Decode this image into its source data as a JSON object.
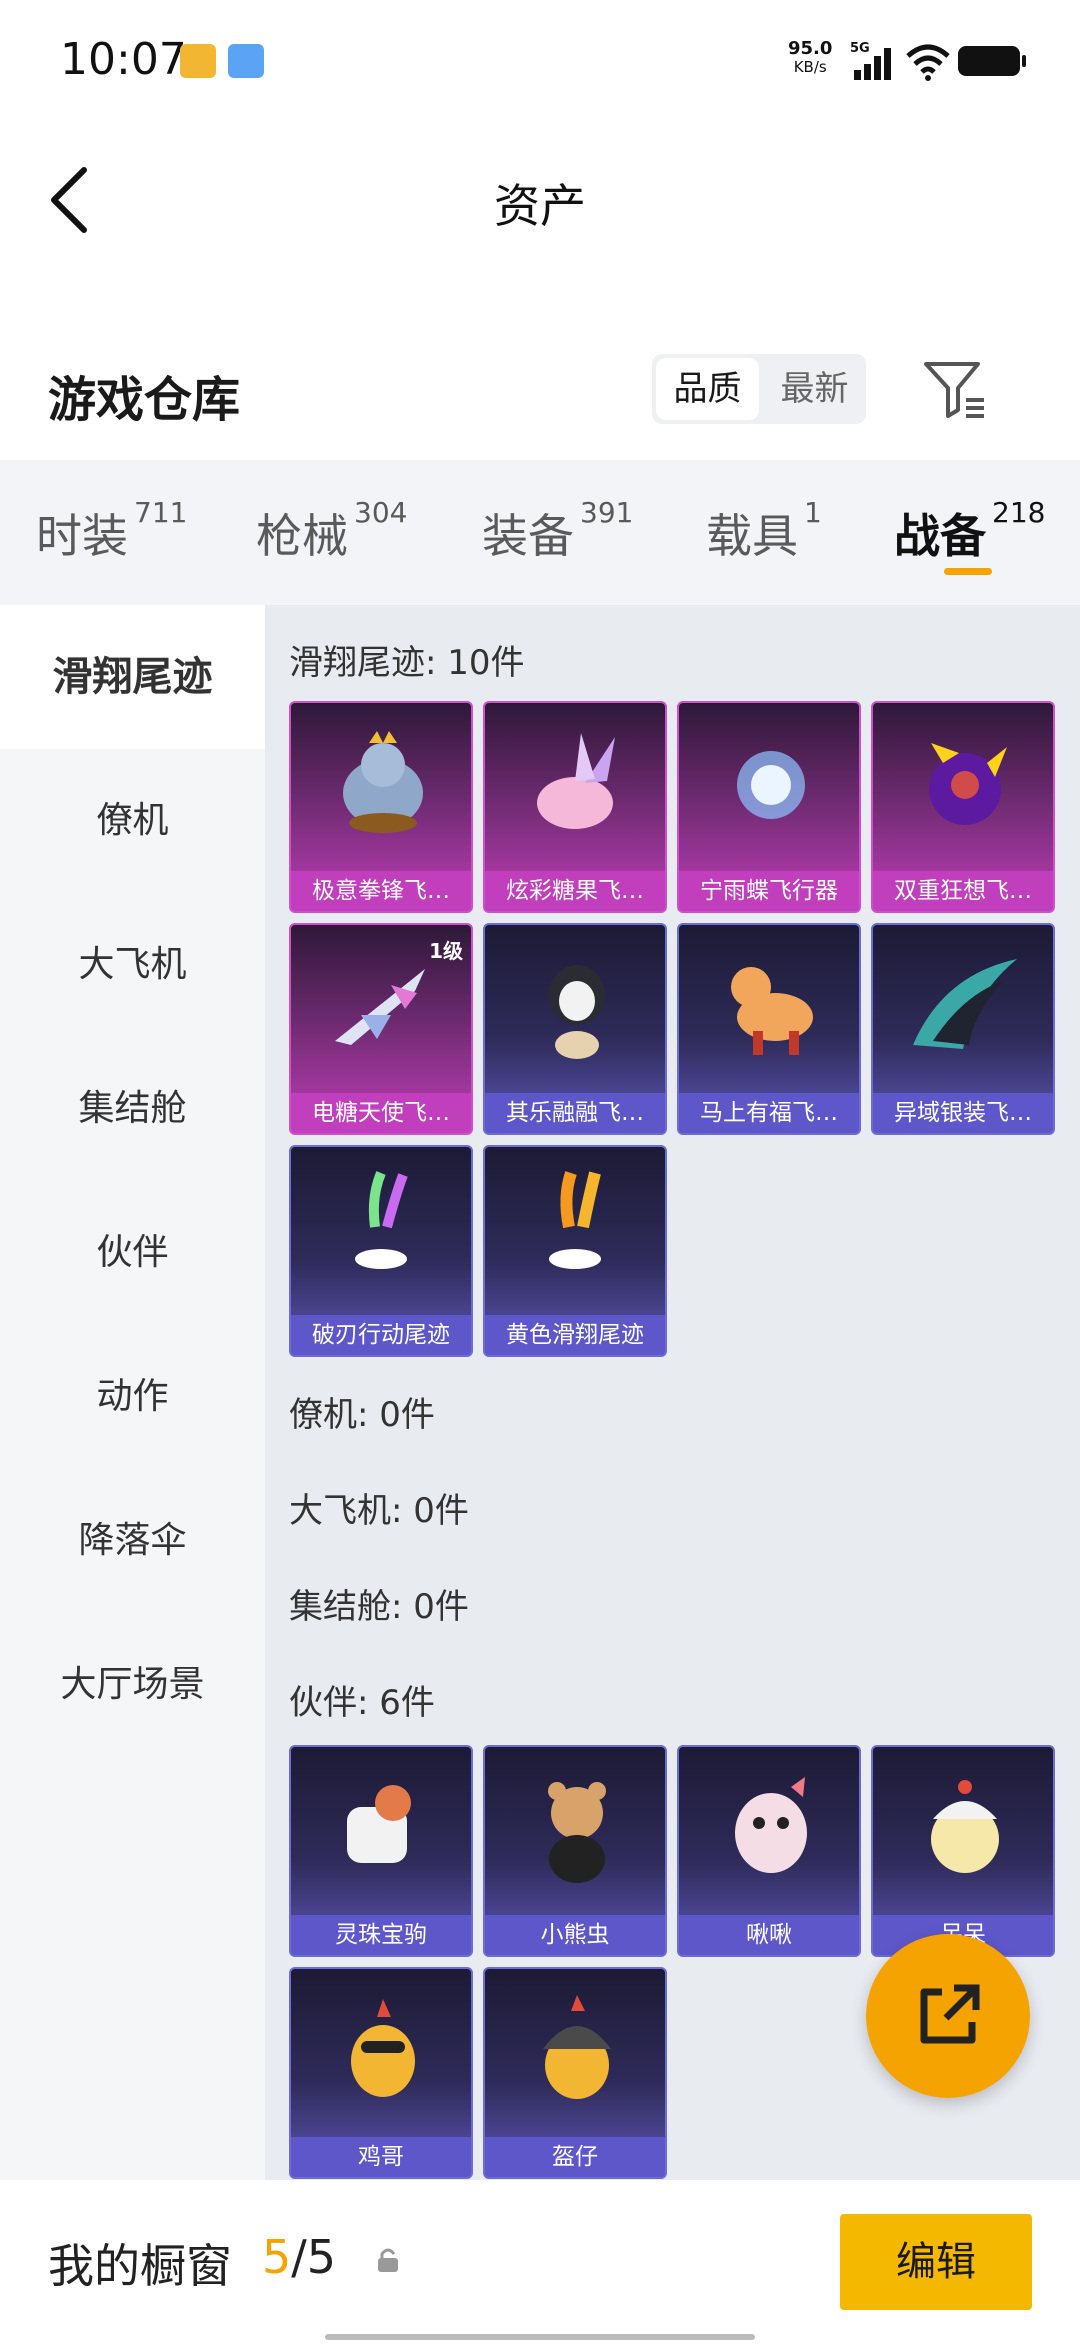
{
  "status_bar": {
    "time": "10:07",
    "speed_value": "95.0",
    "speed_unit": "KB/s",
    "network": "5G"
  },
  "header": {
    "title": "资产"
  },
  "warehouse": {
    "title": "游戏仓库",
    "sort_options": [
      "品质",
      "最新"
    ],
    "active_sort": "品质"
  },
  "category_tabs": [
    {
      "label": "时装",
      "count": "711"
    },
    {
      "label": "枪械",
      "count": "304"
    },
    {
      "label": "装备",
      "count": "391"
    },
    {
      "label": "载具",
      "count": "1"
    },
    {
      "label": "战备",
      "count": "218",
      "active": true
    }
  ],
  "sidebar": {
    "items": [
      "滑翔尾迹",
      "僚机",
      "大飞机",
      "集结舱",
      "伙伴",
      "动作",
      "降落伞",
      "大厅场景"
    ],
    "active": "滑翔尾迹"
  },
  "sections": {
    "glide": {
      "title": "滑翔尾迹: 10件",
      "items": [
        {
          "name": "极意拳锋飞…",
          "rarity": "pink"
        },
        {
          "name": "炫彩糖果飞…",
          "rarity": "pink"
        },
        {
          "name": "宁雨蝶飞行器",
          "rarity": "pink"
        },
        {
          "name": "双重狂想飞…",
          "rarity": "pink"
        },
        {
          "name": "电糖天使飞…",
          "rarity": "pink",
          "level": "1级"
        },
        {
          "name": "其乐融融飞…",
          "rarity": "purple"
        },
        {
          "name": "马上有福飞…",
          "rarity": "purple"
        },
        {
          "name": "异域银装飞…",
          "rarity": "purple"
        },
        {
          "name": "破刃行动尾迹",
          "rarity": "purple"
        },
        {
          "name": "黄色滑翔尾迹",
          "rarity": "purple"
        }
      ]
    },
    "wingman": {
      "title": "僚机: 0件"
    },
    "plane": {
      "title": "大飞机: 0件"
    },
    "cabin": {
      "title": "集结舱: 0件"
    },
    "partner": {
      "title": "伙伴: 6件",
      "items": [
        {
          "name": "灵珠宝驹",
          "rarity": "purple"
        },
        {
          "name": "小熊虫",
          "rarity": "purple"
        },
        {
          "name": "啾啾",
          "rarity": "purple"
        },
        {
          "name": "呆呆",
          "rarity": "purple"
        },
        {
          "name": "鸡哥",
          "rarity": "purple"
        },
        {
          "name": "盔仔",
          "rarity": "purple"
        }
      ]
    }
  },
  "bottom_bar": {
    "label": "我的橱窗",
    "current": "5",
    "separator": "/",
    "total": "5",
    "edit_label": "编辑"
  },
  "colors": {
    "accent": "#f5a300",
    "pink_card": "#c13fbd",
    "purple_card": "#5e57c9"
  }
}
